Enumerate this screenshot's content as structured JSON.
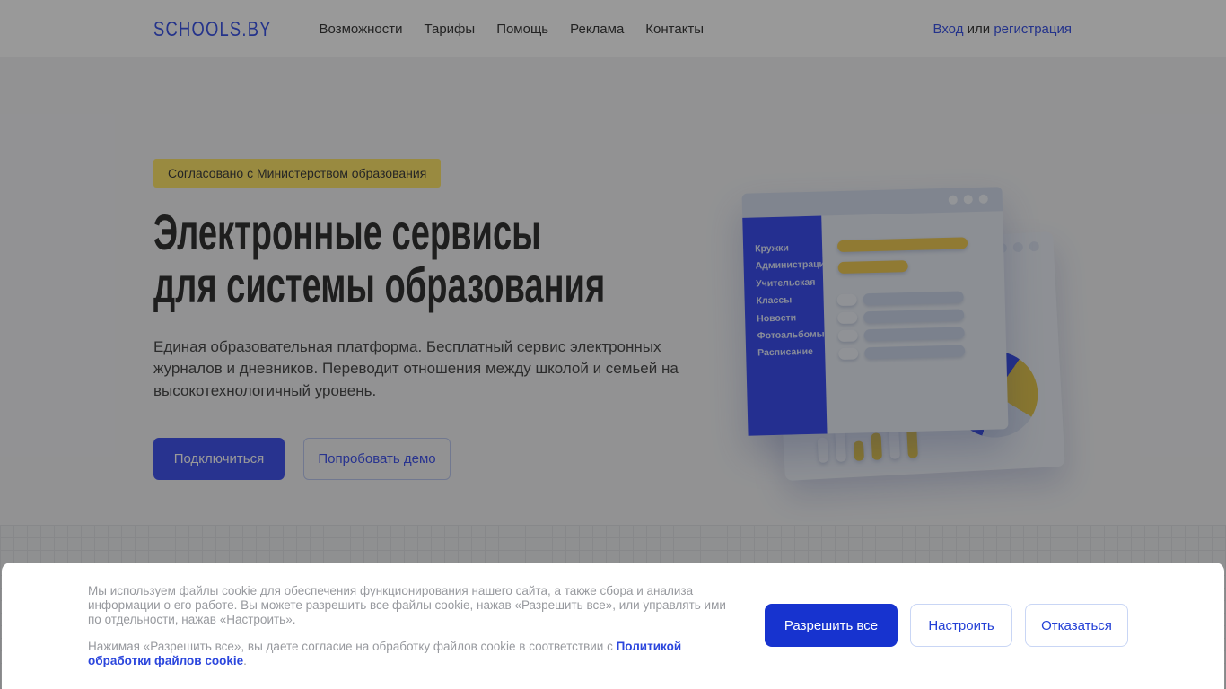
{
  "header": {
    "logo": "SCHOOLS.BY",
    "nav_items": [
      "Возможности",
      "Тарифы",
      "Помощь",
      "Реклама",
      "Контакты"
    ],
    "auth": {
      "login": "Вход",
      "or": " или ",
      "register": "регистрация"
    }
  },
  "hero": {
    "badge": "Согласовано с Министерством образования",
    "title_line1": "Электронные сервисы",
    "title_line2": "для системы образования",
    "description": "Единая образовательная платформа. Бесплатный сервис электронных журналов и дневников. Переводит отношения между школой и семьей на высокотехнологичный уровень.",
    "primary_button": "Подключиться",
    "secondary_button": "Попробовать демо"
  },
  "illustration": {
    "menu_items": [
      "Кружки",
      "Администрация",
      "Учительская",
      "Классы",
      "Новости",
      "Фотоальбомы",
      "Расписание"
    ]
  },
  "cookie_banner": {
    "paragraph1": "Мы используем файлы cookie для обеспечения функционирования нашего сайта, а также сбора и анализа информации о его работе. Вы можете разрешить все файлы cookie, нажав «Разрешить все», или управлять ими по отдельности, нажав «Настроить».",
    "paragraph2_prefix": "Нажимая «Разрешить все», вы даете согласие на обработку файлов cookie в соответствии с ",
    "policy_link": "Политикой обработки файлов cookie",
    "paragraph2_suffix": ".",
    "buttons": {
      "allow_all": "Разрешить все",
      "configure": "Настроить",
      "decline": "Отказаться"
    }
  },
  "colors": {
    "brand_blue": "#3D55E8",
    "primary_button_blue": "#4355EE",
    "cookie_button_blue": "#1733CF",
    "sidebar_blue": "#3D4FF0",
    "badge_yellow": "#FFE76C",
    "accent_yellow": "#E5C74E",
    "overlay": "rgba(0,0,0,0.4)"
  }
}
